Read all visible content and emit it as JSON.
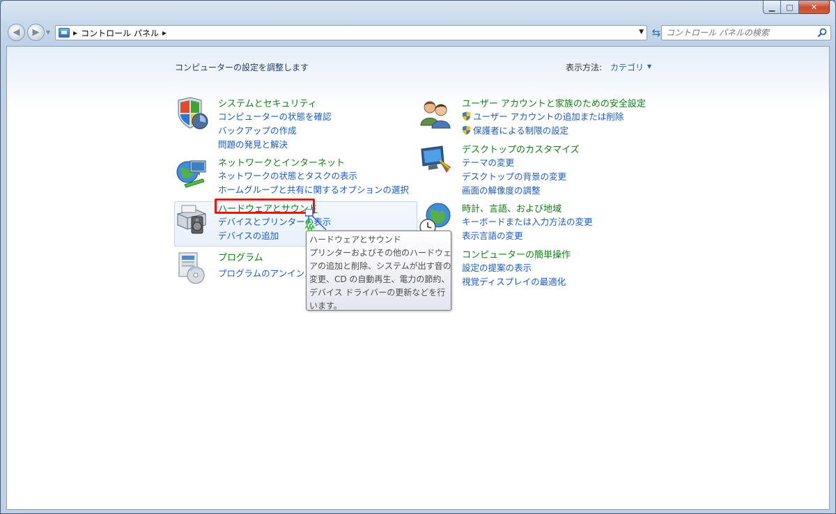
{
  "window": {
    "controls": {
      "minimize": "▭",
      "maximize": "□",
      "close": "✕"
    }
  },
  "navigation": {
    "breadcrumb": [
      "コントロール パネル"
    ],
    "search_placeholder": "コントロール パネルの検索"
  },
  "main": {
    "heading": "コンピューターの設定を調整します",
    "view_by_label": "表示方法:",
    "view_by_value": "カテゴリ"
  },
  "categories": {
    "system": {
      "title": "システムとセキュリティ",
      "links": [
        "コンピューターの状態を確認",
        "バックアップの作成",
        "問題の発見と解決"
      ],
      "icon": "system-security-icon"
    },
    "network": {
      "title": "ネットワークとインターネット",
      "links": [
        "ネットワークの状態とタスクの表示",
        "ホームグループと共有に関するオプションの選択"
      ],
      "icon": "network-icon"
    },
    "hardware": {
      "title": "ハードウェアとサウンド",
      "links": [
        "デバイスとプリンターの表示",
        "デバイスの追加"
      ],
      "icon": "hardware-sound-icon"
    },
    "programs": {
      "title": "プログラム",
      "links": [
        "プログラムのアンインストール"
      ],
      "icon": "programs-icon"
    },
    "users": {
      "title": "ユーザー アカウントと家族のための安全設定",
      "links": [
        "ユーザー アカウントの追加または削除",
        "保護者による制限の設定"
      ],
      "icon": "users-icon"
    },
    "appearance": {
      "title": "デスクトップのカスタマイズ",
      "links": [
        "テーマの変更",
        "デスクトップの背景の変更",
        "画面の解像度の調整"
      ],
      "icon": "appearance-icon"
    },
    "clock": {
      "title": "時計、言語、および地域",
      "links": [
        "キーボードまたは入力方法の変更",
        "表示言語の変更"
      ],
      "icon": "clock-globe-icon"
    },
    "ease": {
      "title": "コンピューターの簡単操作",
      "links": [
        "設定の提案の表示",
        "視覚ディスプレイの最適化"
      ],
      "icon": "ease-of-access-icon"
    }
  },
  "tooltip": {
    "title": "ハードウェアとサウンド",
    "body": "プリンターおよびその他のハードウェアの追加と削除、システムが出す音の変更、CD の自動再生、電力の節約、デバイス ドライバーの更新などを行います。"
  },
  "colors": {
    "category_title": "#127d15",
    "link": "#1b5ac0",
    "highlight": "#e11a10"
  }
}
